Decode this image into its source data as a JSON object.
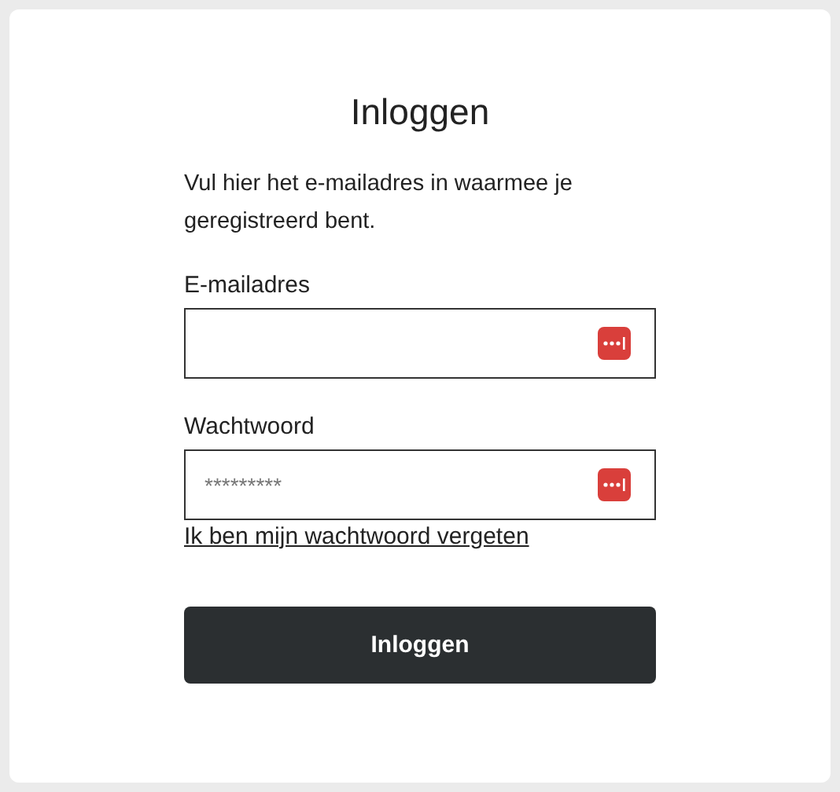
{
  "title": "Inloggen",
  "intro": "Vul hier het e-mailadres in waarmee je geregistreerd bent.",
  "fields": [
    {
      "label": "E-mailadres"
    },
    {
      "label": "Wachtwoord",
      "placeholder": "*********"
    }
  ],
  "forgot_link": "Ik ben mijn wachtwoord vergeten",
  "submit_button": "Inloggen"
}
